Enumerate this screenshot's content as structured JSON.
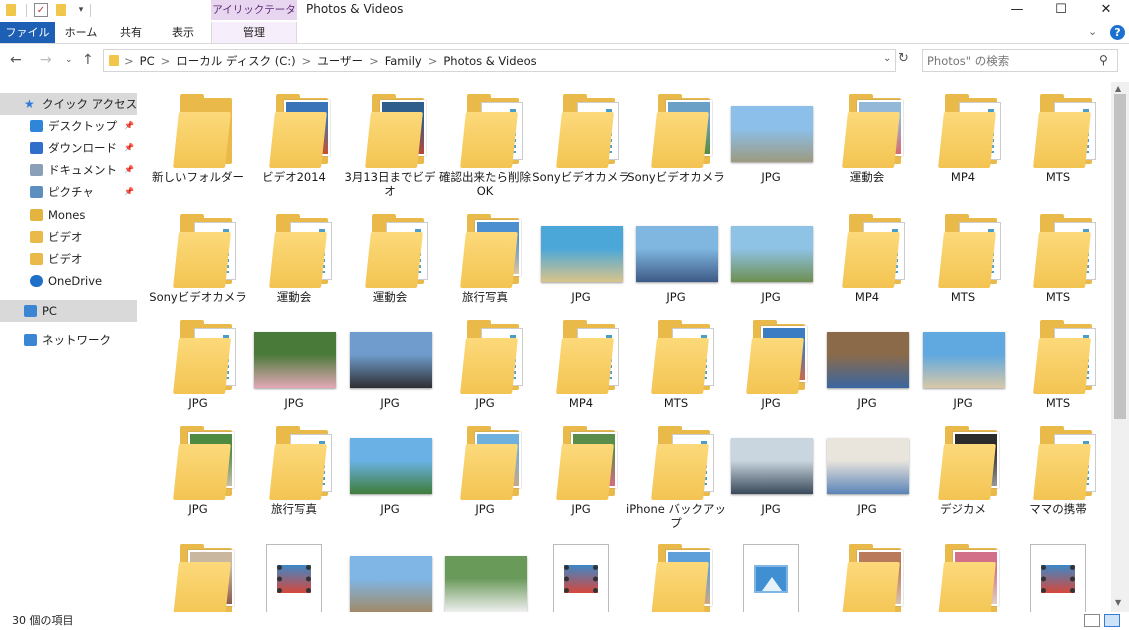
{
  "window": {
    "title": "Photos & Videos",
    "picture_tools": "アイリックテータル",
    "controls": {
      "minimize": "—",
      "maximize": "☐",
      "close": "✕"
    }
  },
  "quick_access_toolbar": {
    "more": "▾"
  },
  "ribbon": {
    "tabs": {
      "file": "ファイル",
      "home": "ホーム",
      "share": "共有",
      "view": "表示",
      "manage": "管理"
    },
    "collapse": "⌄",
    "help": "?"
  },
  "navigation": {
    "back": "←",
    "forward": "→",
    "history": "⌄",
    "up": "↑",
    "breadcrumbs": [
      "PC",
      "ローカル ディスク (C:)",
      "ユーザー",
      "Family",
      "Photos & Videos"
    ],
    "separator": ">",
    "dropdown": "⌄",
    "refresh": "↻"
  },
  "search": {
    "placeholder": "Photos\" の検索",
    "icon": "search-icon"
  },
  "sidebar": {
    "items": [
      {
        "label": "クイック アクセス",
        "icon": "star-icon",
        "color": "#2f7bd6",
        "pinned": false,
        "level": 0,
        "selected": true
      },
      {
        "label": "デスクトップ",
        "icon": "desktop-icon",
        "color": "#2f86d9",
        "pinned": true,
        "level": 1,
        "selected": false
      },
      {
        "label": "ダウンロード",
        "icon": "download-icon",
        "color": "#2f6fc9",
        "pinned": true,
        "level": 1,
        "selected": false
      },
      {
        "label": "ドキュメント",
        "icon": "document-icon",
        "color": "#8aa0b8",
        "pinned": true,
        "level": 1,
        "selected": false
      },
      {
        "label": "ピクチャ",
        "icon": "pictures-icon",
        "color": "#5a8fbf",
        "pinned": true,
        "level": 1,
        "selected": false
      },
      {
        "label": "Mones",
        "icon": "music-icon",
        "color": "#e3b43f",
        "pinned": false,
        "level": 1,
        "selected": false
      },
      {
        "label": "ビデオ",
        "icon": "folder-icon",
        "color": "#e9b949",
        "pinned": false,
        "level": 1,
        "selected": false
      },
      {
        "label": "ビデオ",
        "icon": "folder-icon",
        "color": "#e9b949",
        "pinned": false,
        "level": 1,
        "selected": false
      },
      {
        "label": "OneDrive",
        "icon": "cloud-icon",
        "color": "#1e6fc8",
        "pinned": false,
        "level": 1,
        "selected": false
      },
      {
        "label": "PC",
        "icon": "pc-icon",
        "color": "#3b86d3",
        "pinned": false,
        "level": 0,
        "selected": true
      },
      {
        "label": "ネットワーク",
        "icon": "network-icon",
        "color": "#3b86d3",
        "pinned": false,
        "level": 0,
        "selected": false
      }
    ]
  },
  "files": [
    {
      "label": "新しいフォルダー",
      "kind": "folder-empty"
    },
    {
      "label": "ビデオ2014",
      "kind": "folder-photo",
      "colors": [
        "#3a74b8",
        "#c9502e"
      ]
    },
    {
      "label": "3月13日までビデオ",
      "kind": "folder-photo",
      "colors": [
        "#2f5d8c",
        "#b94835"
      ]
    },
    {
      "label": "確認出来たら削除OK",
      "kind": "folder-doc"
    },
    {
      "label": "Sonyビデオカメラ",
      "kind": "folder-doc"
    },
    {
      "label": "Sonyビデオカメラ",
      "kind": "folder-photo",
      "colors": [
        "#6aa0c6",
        "#5b8a3c"
      ]
    },
    {
      "label": "JPG",
      "kind": "photo",
      "colors": [
        "#8cc0ea",
        "#9c9a80"
      ]
    },
    {
      "label": "運動会",
      "kind": "folder-photo",
      "colors": [
        "#94b8d8",
        "#d96a6a"
      ]
    },
    {
      "label": "MP4",
      "kind": "folder-doc"
    },
    {
      "label": "MTS",
      "kind": "folder-doc"
    },
    {
      "label": "Sonyビデオカメラ",
      "kind": "folder-doc"
    },
    {
      "label": "運動会",
      "kind": "folder-doc"
    },
    {
      "label": "運動会",
      "kind": "folder-doc"
    },
    {
      "label": "旅行写真",
      "kind": "folder-photo",
      "colors": [
        "#4b8fd0",
        "#e2c7a0"
      ]
    },
    {
      "label": "JPG",
      "kind": "photo",
      "colors": [
        "#4aa7d8",
        "#d9c48a"
      ]
    },
    {
      "label": "JPG",
      "kind": "photo",
      "colors": [
        "#7fb7e0",
        "#3d5a86"
      ]
    },
    {
      "label": "JPG",
      "kind": "photo",
      "colors": [
        "#8fc3e6",
        "#6e8f52"
      ]
    },
    {
      "label": "MP4",
      "kind": "folder-doc"
    },
    {
      "label": "MTS",
      "kind": "folder-doc"
    },
    {
      "label": "MTS",
      "kind": "folder-doc"
    },
    {
      "label": "JPG",
      "kind": "folder-doc"
    },
    {
      "label": "JPG",
      "kind": "photo",
      "colors": [
        "#4a7a3a",
        "#e3a9b6"
      ]
    },
    {
      "label": "JPG",
      "kind": "photo",
      "colors": [
        "#6f9ccc",
        "#2f2f33"
      ]
    },
    {
      "label": "JPG",
      "kind": "folder-doc"
    },
    {
      "label": "MP4",
      "kind": "folder-doc"
    },
    {
      "label": "MTS",
      "kind": "folder-doc"
    },
    {
      "label": "JPG",
      "kind": "folder-photo",
      "colors": [
        "#3c7cc2",
        "#cf6a48"
      ]
    },
    {
      "label": "JPG",
      "kind": "photo",
      "colors": [
        "#8b6a4a",
        "#3a66a0"
      ]
    },
    {
      "label": "JPG",
      "kind": "photo",
      "colors": [
        "#5fa8e0",
        "#d8c8a8"
      ]
    },
    {
      "label": "MTS",
      "kind": "folder-doc"
    },
    {
      "label": "JPG",
      "kind": "folder-photo",
      "colors": [
        "#4e8a40",
        "#c8c0b0"
      ]
    },
    {
      "label": "旅行写真",
      "kind": "folder-doc"
    },
    {
      "label": "JPG",
      "kind": "photo",
      "colors": [
        "#6ab2e6",
        "#3f7d3a"
      ]
    },
    {
      "label": "JPG",
      "kind": "folder-photo",
      "colors": [
        "#6fb0dc",
        "#c9a887"
      ]
    },
    {
      "label": "JPG",
      "kind": "folder-photo",
      "colors": [
        "#5a8c4a",
        "#d86a86"
      ]
    },
    {
      "label": "iPhone バックアップ",
      "kind": "folder-doc"
    },
    {
      "label": "JPG",
      "kind": "photo",
      "colors": [
        "#c9d6df",
        "#3a4a5a"
      ]
    },
    {
      "label": "JPG",
      "kind": "photo",
      "colors": [
        "#e9e4dc",
        "#5a84b8"
      ]
    },
    {
      "label": "デジカメ",
      "kind": "folder-photo",
      "colors": [
        "#2c2c2c",
        "#9a9a9a"
      ]
    },
    {
      "label": "ママの携帯",
      "kind": "folder-doc"
    },
    {
      "label": "",
      "kind": "folder-photo",
      "colors": [
        "#c9b79f",
        "#8a5a4a"
      ]
    },
    {
      "label": "",
      "kind": "video"
    },
    {
      "label": "",
      "kind": "photo",
      "colors": [
        "#7fb6e6",
        "#a08a68"
      ]
    },
    {
      "label": "",
      "kind": "photo",
      "colors": [
        "#6a9a5a",
        "#efefef"
      ]
    },
    {
      "label": "",
      "kind": "video"
    },
    {
      "label": "",
      "kind": "folder-photo",
      "colors": [
        "#5e9fd9",
        "#d2a880"
      ]
    },
    {
      "label": "",
      "kind": "image-file"
    },
    {
      "label": "",
      "kind": "folder-photo",
      "colors": [
        "#b87a5a",
        "#d9c5b0"
      ]
    },
    {
      "label": "",
      "kind": "folder-photo",
      "colors": [
        "#d2708a",
        "#e0d2c2"
      ]
    },
    {
      "label": "",
      "kind": "video"
    }
  ],
  "scrollbar": {
    "up": "▲",
    "down": "▼"
  },
  "status": {
    "count": "30 個の項目"
  }
}
